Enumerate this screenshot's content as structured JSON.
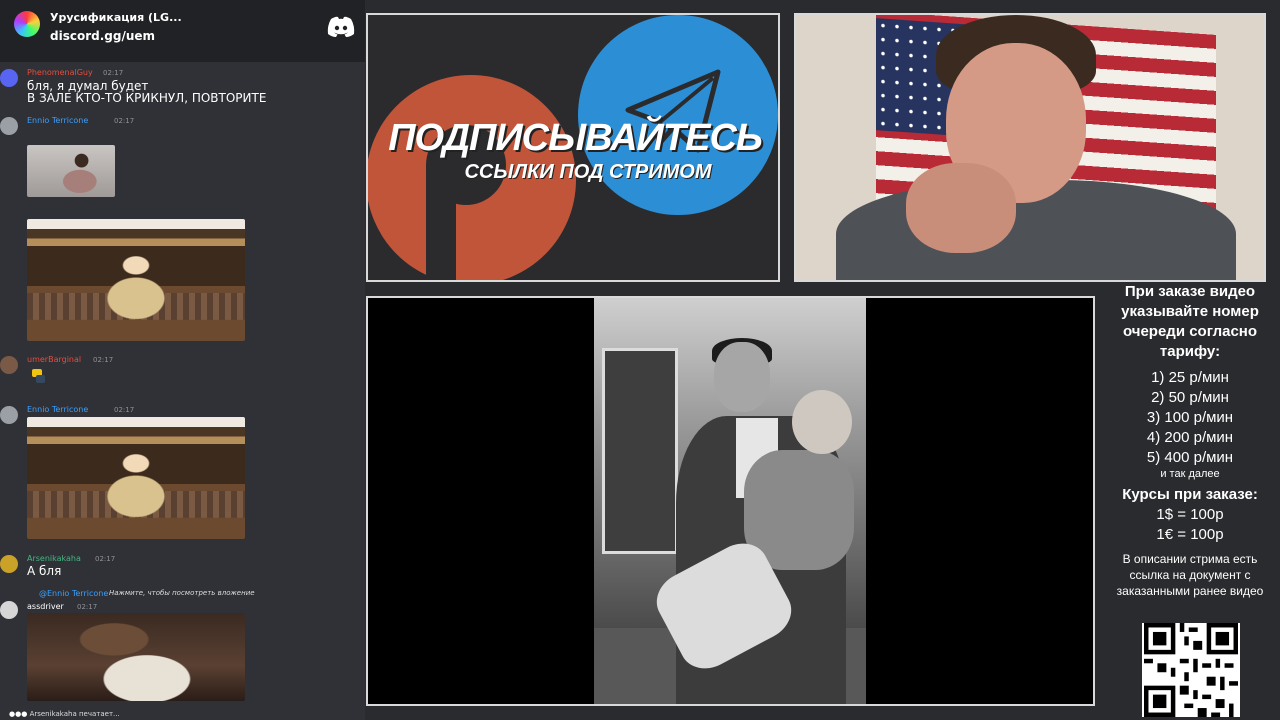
{
  "chat": {
    "server_name": "Урусификация (LG...",
    "invite": "discord.gg/uem",
    "messages": [
      {
        "user": "PhenomenalGuy",
        "user_color": "#e74c3c",
        "time": "02:17",
        "lines": [
          "бля, я думал будет",
          "В ЗАЛЕ КТО-ТО КРИКНУЛ, ПОВТОРИТЕ"
        ]
      },
      {
        "user": "Ennio Terricone",
        "user_color": "#3ba0ff",
        "time": "02:17",
        "lines": []
      },
      {
        "user": "umerBarginal",
        "user_color": "#e74c3c",
        "time": "02:17",
        "lines": []
      },
      {
        "user": "Ennio Terricone",
        "user_color": "#3ba0ff",
        "time": "02:17",
        "lines": []
      },
      {
        "user": "Arsenikakaha",
        "user_color": "#43b581",
        "time": "02:17",
        "lines": [
          "А бля"
        ]
      },
      {
        "user": "assdriver",
        "user_color": "#ffffff",
        "time": "02:17",
        "reply_to": "@Ennio Terricone",
        "reply_text": "Нажмите, чтобы посмотреть вложение",
        "lines": []
      }
    ],
    "typing": "Arsenikakaha печатает..."
  },
  "promo": {
    "title": "ПОДПИСЫВАЙТЕСЬ",
    "subtitle": "ССЫЛКИ ПОД СТРИМОМ",
    "colors": {
      "patreon": "#c0553a",
      "telegram": "#2c8fd6"
    }
  },
  "info": {
    "intro": "При заказе видео указывайте номер очереди согласно тарифу:",
    "tariffs": [
      "1) 25 р/мин",
      "2) 50 р/мин",
      "3) 100 р/мин",
      "4) 200 р/мин",
      "5) 400 р/мин"
    ],
    "etc": "и так далее",
    "rates_title": "Курсы при заказе:",
    "rates": [
      "1$ = 100р",
      "1€ = 100р"
    ],
    "footer": "В описании стрима есть ссылка на документ с заказанными ранее видео"
  }
}
